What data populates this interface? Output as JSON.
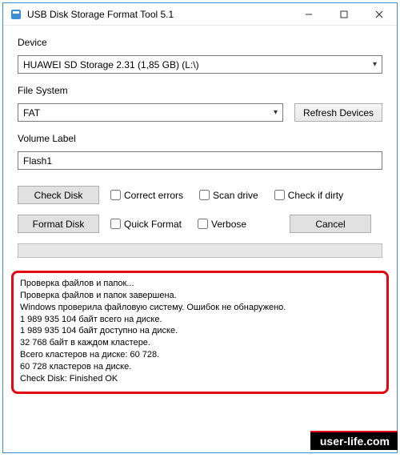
{
  "window": {
    "title": "USB Disk Storage Format Tool 5.1"
  },
  "labels": {
    "device": "Device",
    "file_system": "File System",
    "volume_label": "Volume Label"
  },
  "device": {
    "selected": "HUAWEI  SD Storage  2.31 (1,85 GB) (L:\\)"
  },
  "file_system": {
    "selected": "FAT"
  },
  "buttons": {
    "refresh": "Refresh Devices",
    "check_disk": "Check Disk",
    "format_disk": "Format Disk",
    "cancel": "Cancel"
  },
  "volume": {
    "value": "Flash1"
  },
  "checks": {
    "correct_errors": "Correct errors",
    "scan_drive": "Scan drive",
    "check_if_dirty": "Check if dirty",
    "quick_format": "Quick Format",
    "verbose": "Verbose"
  },
  "log": "Проверка файлов и папок...\nПроверка файлов и папок завершена.\nWindows проверила файловую систему. Ошибок не обнаружено.\n1 989 935 104 байт всего на диске.\n1 989 935 104 байт доступно на диске.\n32 768 байт в каждом кластере.\nВсего кластеров на диске:          60 728.\n60 728 кластеров на диске.\nCheck Disk: Finished OK",
  "watermark": "user-life.com"
}
